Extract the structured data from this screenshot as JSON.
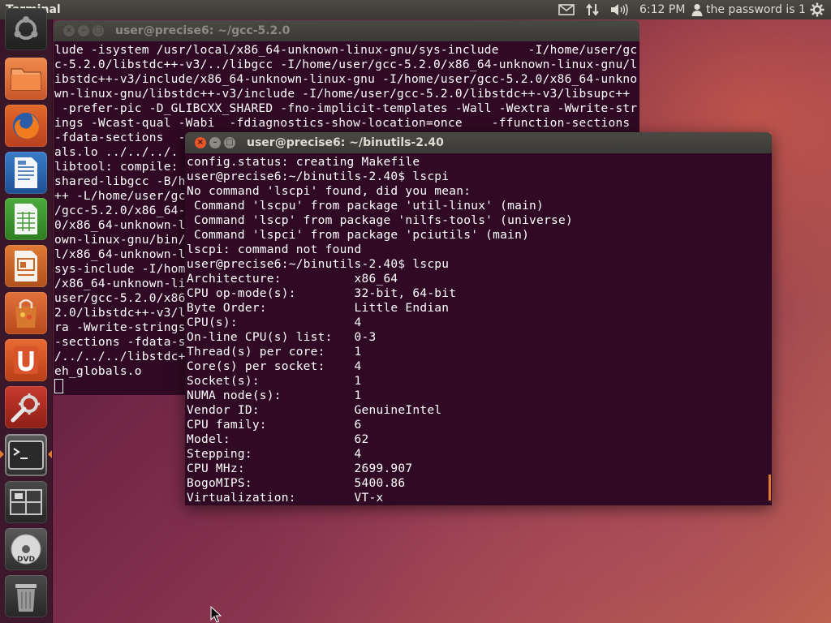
{
  "top_panel": {
    "app_name": "Terminal",
    "clock": "6:12 PM",
    "user_label": "the password is 1",
    "indicators": [
      "mail-icon",
      "network-transfer-icon",
      "volume-icon",
      "user-icon",
      "power-gear-icon"
    ]
  },
  "launcher": {
    "items": [
      {
        "name": "dash-home",
        "icon": "ubuntu-logo-icon"
      },
      {
        "name": "files",
        "icon": "folder-icon"
      },
      {
        "name": "firefox",
        "icon": "firefox-icon"
      },
      {
        "name": "libreoffice-writer",
        "icon": "writer-document-icon"
      },
      {
        "name": "libreoffice-calc",
        "icon": "calc-spreadsheet-icon"
      },
      {
        "name": "libreoffice-impress",
        "icon": "impress-presentation-icon"
      },
      {
        "name": "software-center",
        "icon": "shopping-bag-icon"
      },
      {
        "name": "ubuntu-one",
        "icon": "ubuntu-one-icon"
      },
      {
        "name": "system-settings",
        "icon": "wrench-gear-icon"
      },
      {
        "name": "terminal",
        "icon": "terminal-icon",
        "active": true
      },
      {
        "name": "workspace-switcher",
        "icon": "workspaces-icon"
      },
      {
        "name": "dvd",
        "icon": "dvd-disc-icon"
      },
      {
        "name": "trash",
        "icon": "trash-icon"
      }
    ],
    "accent": "#e07a30"
  },
  "back_window": {
    "title": "user@precise6: ~/gcc-5.2.0",
    "lines": [
      "lude -isystem /usr/local/x86_64-unknown-linux-gnu/sys-include    -I/home/user/gc",
      "c-5.2.0/libstdc++-v3/../libgcc -I/home/user/gcc-5.2.0/x86_64-unknown-linux-gnu/l",
      "ibstdc++-v3/include/x86_64-unknown-linux-gnu -I/home/user/gcc-5.2.0/x86_64-unkno",
      "wn-linux-gnu/libstdc++-v3/include -I/home/user/gcc-5.2.0/libstdc++-v3/libsupc++",
      " -prefer-pic -D_GLIBCXX_SHARED -fno-implicit-templates -Wall -Wextra -Wwrite-str",
      "ings -Wcast-qual -Wabi  -fdiagnostics-show-location=once    -ffunction-sections",
      "-fdata-sections  -",
      "als.lo ../../../.",
      "libtool: compile:",
      "shared-libgcc -B/h",
      "++ -L/home/user/gc",
      "/gcc-5.2.0/x86_64-",
      "0/x86_64-unknown-l",
      "own-linux-gnu/bin/",
      "l/x86_64-unknown-l",
      "sys-include -I/hom",
      "/x86_64-unknown-li",
      "user/gcc-5.2.0/x86",
      "2.0/libstdc++-v3/l",
      "ra -Wwrite-strings",
      "-sections -fdata-s",
      "/../../../libstdc++",
      "eh_globals.o"
    ]
  },
  "front_window": {
    "title": "user@precise6: ~/binutils-2.40",
    "lines": [
      "config.status: creating Makefile",
      "user@precise6:~/binutils-2.40$ lscpi",
      "No command 'lscpi' found, did you mean:",
      " Command 'lscpu' from package 'util-linux' (main)",
      " Command 'lscp' from package 'nilfs-tools' (universe)",
      " Command 'lspci' from package 'pciutils' (main)",
      "lscpi: command not found",
      "user@precise6:~/binutils-2.40$ lscpu",
      "Architecture:          x86_64",
      "CPU op-mode(s):        32-bit, 64-bit",
      "Byte Order:            Little Endian",
      "CPU(s):                4",
      "On-line CPU(s) list:   0-3",
      "Thread(s) per core:    1",
      "Core(s) per socket:    4",
      "Socket(s):             1",
      "NUMA node(s):          1",
      "Vendor ID:             GenuineIntel",
      "CPU family:            6",
      "Model:                 62",
      "Stepping:              4",
      "CPU MHz:               2699.907",
      "BogoMIPS:              5400.86",
      "Virtualization:        VT-x"
    ]
  },
  "window_buttons": {
    "close": "×",
    "minimize": "–",
    "maximize": "□"
  },
  "colors": {
    "terminal_bg": "#300a24",
    "close_button": "#e9552b",
    "title_active": "#dfdbd2",
    "title_inactive": "#8c8a84",
    "scrollbar": "#e07a30"
  }
}
